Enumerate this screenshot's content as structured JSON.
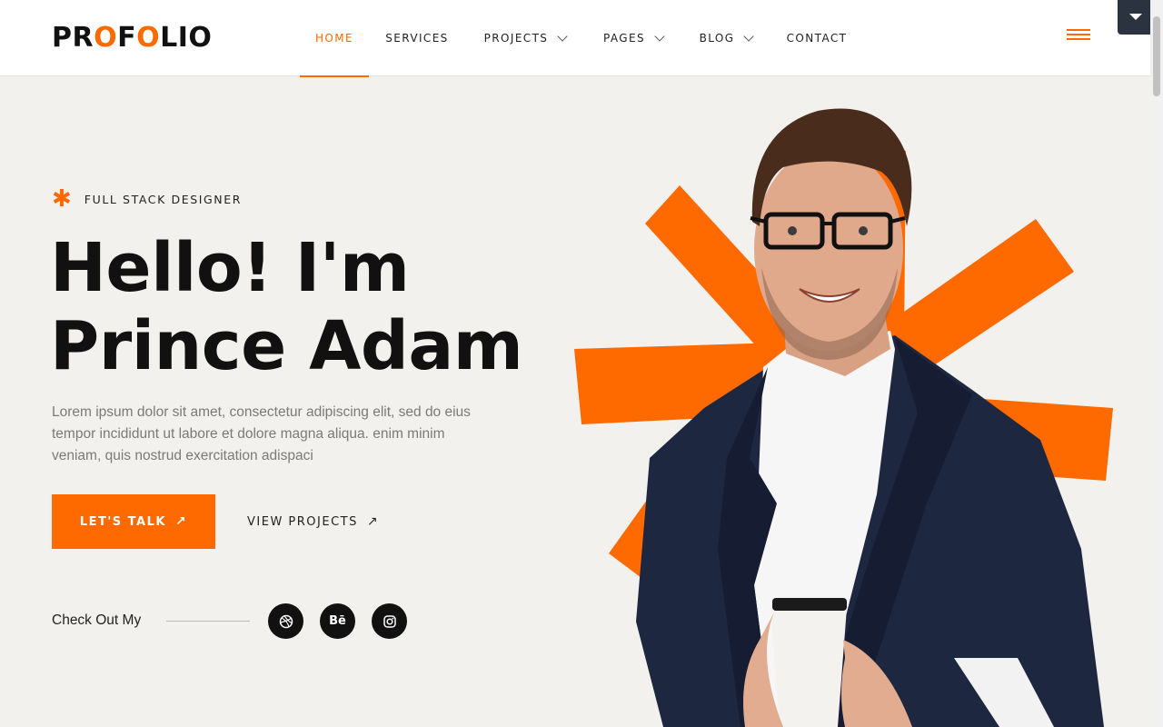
{
  "brand": {
    "logo_part1": "PR",
    "logo_o1": "O",
    "logo_part2": "F",
    "logo_o2": "O",
    "logo_part3": "LIO"
  },
  "nav": {
    "items": [
      {
        "label": "HOME",
        "active": true,
        "dropdown": false
      },
      {
        "label": "SERVICES",
        "dropdown": false
      },
      {
        "label": "PROJECTS",
        "dropdown": true
      },
      {
        "label": "PAGES",
        "dropdown": true
      },
      {
        "label": "BLOG",
        "dropdown": true
      },
      {
        "label": "CONTACT",
        "dropdown": false
      }
    ]
  },
  "hero": {
    "tagline": "FULL STACK DESIGNER",
    "title_line1": "Hello! I'm",
    "title_line2": "Prince Adam",
    "description": "Lorem ipsum dolor sit amet, consectetur adipiscing elit, sed do eius tempor incididunt ut labore et dolore magna aliqua. enim minim veniam, quis nostrud exercitation adispaci",
    "cta_primary": "LET'S TALK",
    "cta_secondary": "VIEW PROJECTS",
    "checkout_label": "Check Out My",
    "socials": [
      {
        "name": "dribbble-icon",
        "glyph": ""
      },
      {
        "name": "behance-icon",
        "glyph": "Bē"
      },
      {
        "name": "instagram-icon",
        "glyph": ""
      }
    ]
  },
  "colors": {
    "accent": "#ff6a00",
    "background": "#f3f1ee",
    "text": "#111111",
    "muted": "#7a7a7a",
    "jacket": "#1e2740"
  }
}
